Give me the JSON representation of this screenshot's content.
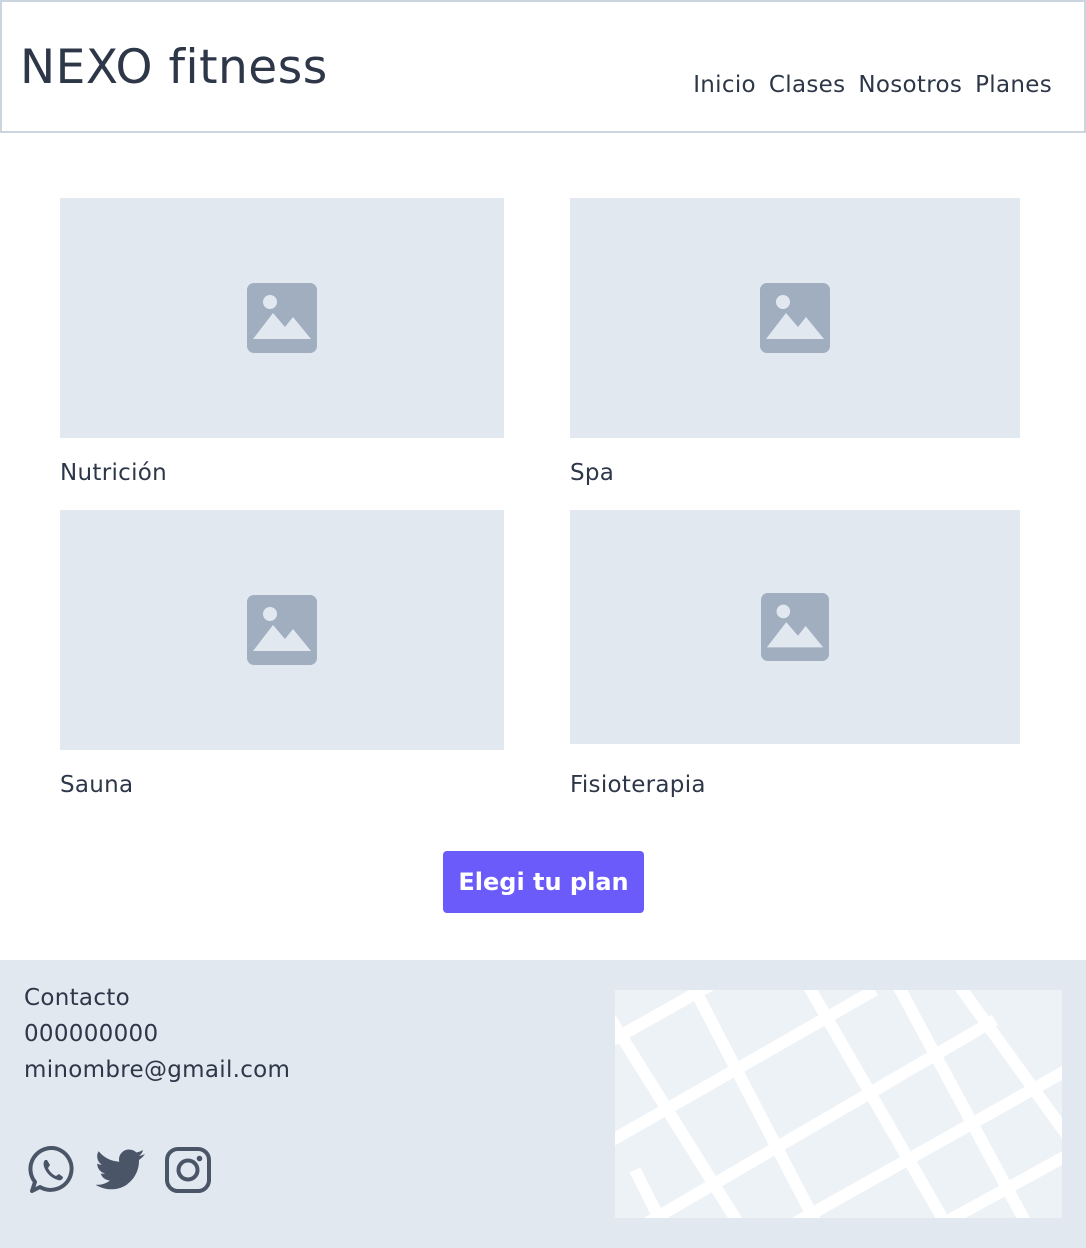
{
  "header": {
    "logo": "NEXO fitness",
    "nav": [
      "Inicio",
      "Clases",
      "Nosotros",
      "Planes"
    ]
  },
  "services": [
    {
      "label": "Nutrición",
      "icon": "image-placeholder-icon"
    },
    {
      "label": "Spa",
      "icon": "image-placeholder-icon"
    },
    {
      "label": "Sauna",
      "icon": "image-placeholder-icon"
    },
    {
      "label": "Fisioterapia",
      "icon": "image-placeholder-icon"
    }
  ],
  "cta": {
    "label": "Elegi tu plan"
  },
  "footer": {
    "contact_title": "Contacto",
    "phone": "000000000",
    "email": "minombre@gmail.com",
    "social": [
      "whatsapp-icon",
      "twitter-icon",
      "instagram-icon"
    ],
    "map": "map-image"
  },
  "colors": {
    "accent": "#6b5bfb",
    "text": "#2d3748",
    "placeholder_bg": "#e2e8f0",
    "placeholder_icon": "#a0aec0"
  }
}
